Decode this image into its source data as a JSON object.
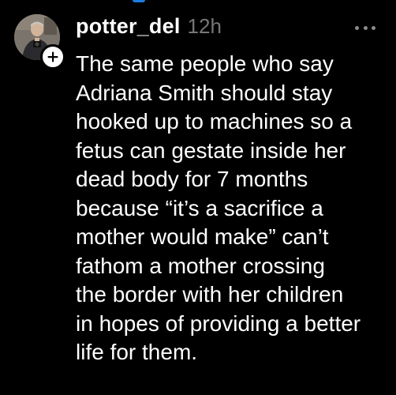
{
  "post": {
    "username": "potter_del",
    "timestamp": "12h",
    "lines": [
      "The same people who say",
      "Adriana Smith should stay",
      "hooked up to machines so a",
      "fetus can gestate inside her",
      "dead body for 7 months",
      "because “it’s a sacrifice a",
      "mother would make” can’t",
      "fathom a mother crossing",
      "the border with her children",
      "in hopes of providing a better",
      "life for them."
    ]
  },
  "icons": {
    "more": "more-options-icon",
    "follow": "plus-icon",
    "avatar": "avatar"
  },
  "colors": {
    "background": "#000000",
    "text": "#ffffff",
    "muted": "#777777",
    "accent": "#1d7be0"
  }
}
